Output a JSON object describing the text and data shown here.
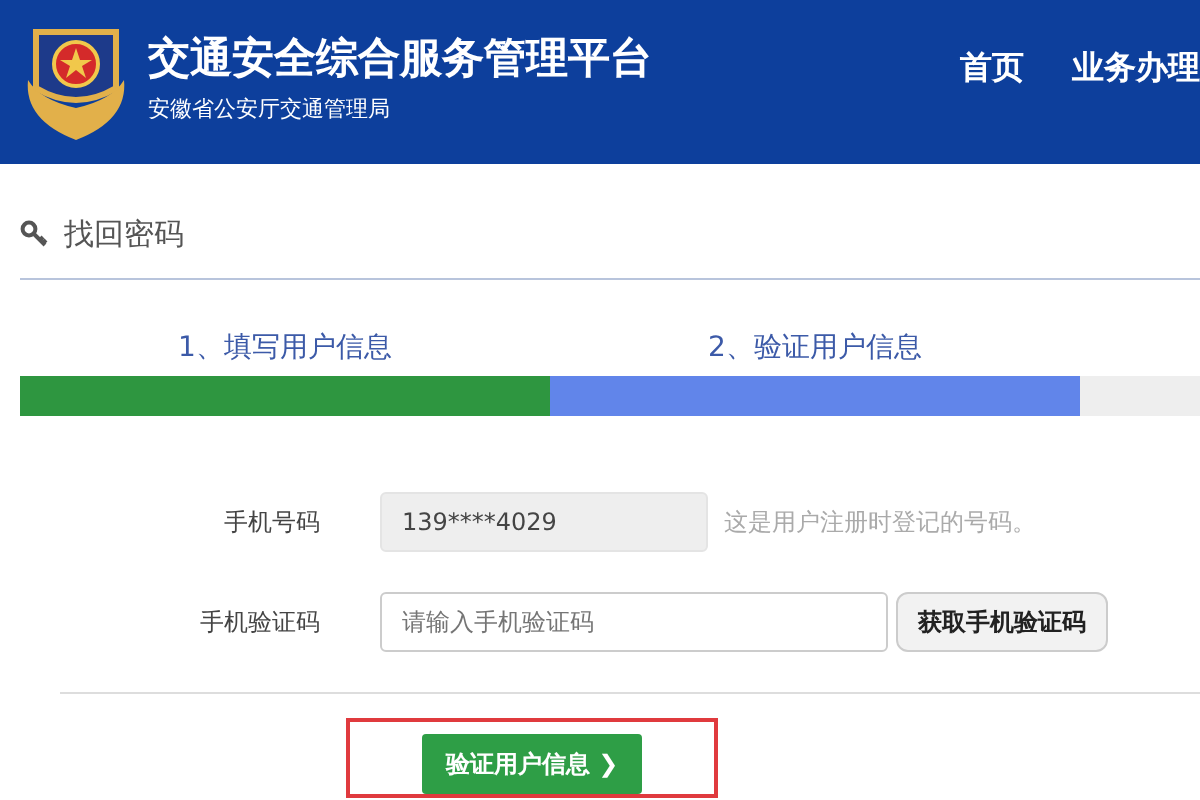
{
  "header": {
    "title": "交通安全综合服务管理平台",
    "subtitle": "安徽省公安厅交通管理局",
    "nav": [
      {
        "label": "首页"
      },
      {
        "label": "业务办理"
      }
    ]
  },
  "page_title": "找回密码",
  "steps": [
    {
      "label": "1、填写用户信息",
      "selected": false
    },
    {
      "label": "2、验证用户信息",
      "selected": true
    },
    {
      "selected": false
    }
  ],
  "form": {
    "phone_label": "手机号码",
    "phone_value": "139****4029",
    "phone_hint": "这是用户注册时登记的号码。",
    "code_label": "手机验证码",
    "code_placeholder": "请输入手机验证码",
    "code_button": "获取手机验证码"
  },
  "submit": {
    "label": "验证用户信息",
    "icon": "❯",
    "highlighted": true
  }
}
